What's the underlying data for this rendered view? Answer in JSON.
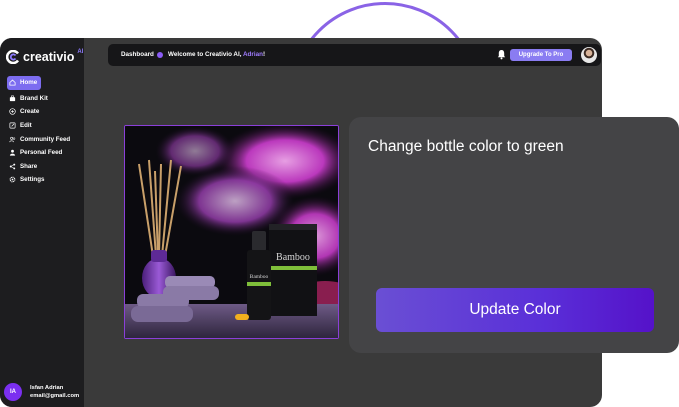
{
  "app": {
    "brand": "creativio",
    "brand_sup": "AI"
  },
  "sidebar": {
    "items": [
      {
        "label": "Home",
        "icon": "home-icon",
        "active": true
      },
      {
        "label": "Brand Kit",
        "icon": "brand-kit-icon"
      },
      {
        "label": "Create",
        "icon": "plus-circle-icon"
      },
      {
        "label": "Edit",
        "icon": "edit-icon"
      },
      {
        "label": "Community Feed",
        "icon": "community-icon"
      },
      {
        "label": "Personal Feed",
        "icon": "user-icon"
      },
      {
        "label": "Share",
        "icon": "share-icon"
      },
      {
        "label": "Settings",
        "icon": "gear-icon"
      }
    ],
    "user": {
      "initials": "IA",
      "name": "Isfan Adrian",
      "email": "email@gmail.com"
    }
  },
  "topbar": {
    "breadcrumb": "Dashboard",
    "welcome_prefix": "Welcome to Creativio AI, ",
    "welcome_name": "Adrian",
    "welcome_suffix": "!",
    "upgrade_label": "Upgrade To Pro"
  },
  "product_image": {
    "label_left": "Bamboo",
    "label_right": "Bamboo"
  },
  "edit_panel": {
    "prompt": "Change bottle color to green",
    "action_label": "Update Color"
  },
  "colors": {
    "accent": "#7c6cf0",
    "button_gradient_start": "#6a4fd4",
    "button_gradient_end": "#5512c9"
  }
}
